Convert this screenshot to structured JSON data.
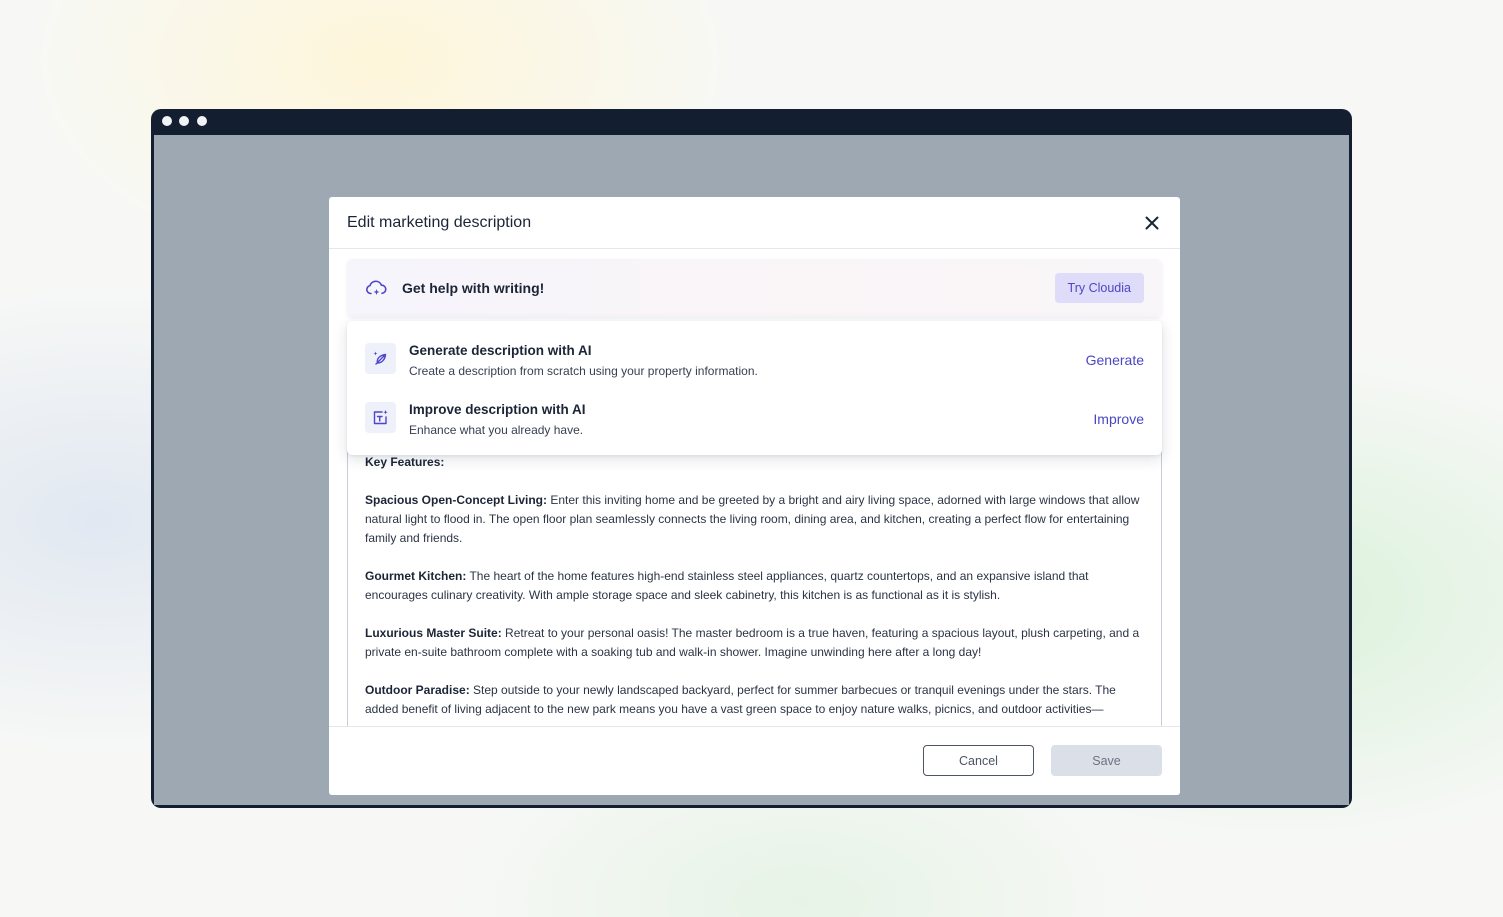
{
  "modal": {
    "title": "Edit marketing description"
  },
  "helper": {
    "text": "Get help with writing!",
    "try_label": "Try Cloudia"
  },
  "ai_options": [
    {
      "title": "Generate description with AI",
      "subtitle": "Create a description from scratch using your property information.",
      "action": "Generate"
    },
    {
      "title": "Improve description with AI",
      "subtitle": "Enhance what you already have.",
      "action": "Improve"
    }
  ],
  "description": {
    "heading": "Key Features:",
    "paragraphs": [
      {
        "label": "Spacious Open-Concept Living:",
        "text": " Enter this inviting home and be greeted by a bright and airy living space, adorned with large windows that allow natural light to flood in. The open floor plan seamlessly connects the living room, dining area, and kitchen, creating a perfect flow for entertaining family and friends."
      },
      {
        "label": "Gourmet Kitchen:",
        "text": " The heart of the home features high-end stainless steel appliances, quartz countertops, and an expansive island that encourages culinary creativity. With ample storage space and sleek cabinetry, this kitchen is as functional as it is stylish."
      },
      {
        "label": "Luxurious Master Suite:",
        "text": " Retreat to your personal oasis! The master bedroom is a true haven, featuring a spacious layout, plush carpeting, and a private en-suite bathroom complete with a soaking tub and walk-in shower. Imagine unwinding here after a long day!"
      },
      {
        "label": "Outdoor Paradise:",
        "text": " Step outside to your newly landscaped backyard, perfect for summer barbecues or tranquil evenings under the stars. The added benefit of living adjacent to the new park means you have a vast green space to enjoy nature walks, picnics, and outdoor activities—"
      }
    ]
  },
  "footer": {
    "cancel_label": "Cancel",
    "save_label": "Save"
  },
  "colors": {
    "accent": "#4a46c4",
    "try_button_bg": "#dfdcfa",
    "window_frame": "#131e30",
    "overlay": "#9ea8b3"
  },
  "icons": {
    "close": "close-icon",
    "helper": "cloud-sparkle-icon",
    "generate": "feather-sparkle-icon",
    "improve": "text-sparkle-icon"
  }
}
